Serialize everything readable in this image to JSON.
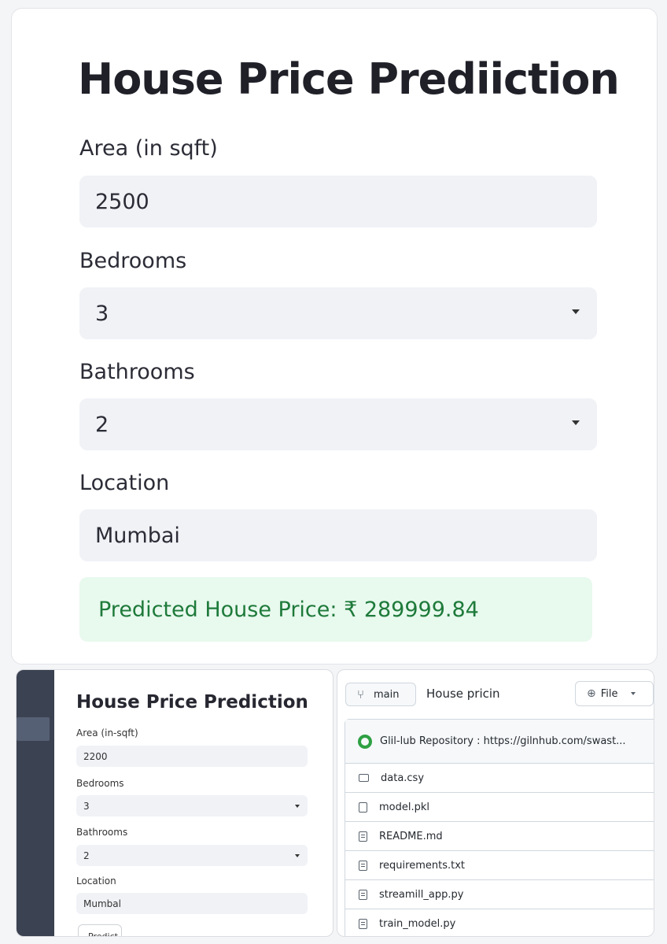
{
  "main_app": {
    "title": "House Price Prediiction",
    "fields": [
      {
        "label": "Area (in sqft)",
        "value": "2500",
        "type": "number"
      },
      {
        "label": "Bedrooms",
        "value": "3",
        "type": "select"
      },
      {
        "label": "Bathrooms",
        "value": "2",
        "type": "select"
      },
      {
        "label": "Location",
        "value": "Mumbai",
        "type": "text"
      }
    ],
    "result": "Predicted House Price: ₹ 289999.84"
  },
  "preview_app": {
    "title": "House Price Prediction",
    "fields": [
      {
        "label": "Area (in-sqft)",
        "value": "2200",
        "type": "number"
      },
      {
        "label": "Bedrooms",
        "value": "3",
        "type": "select"
      },
      {
        "label": "Bathrooms",
        "value": "2",
        "type": "select"
      },
      {
        "label": "Location",
        "value": "Mumbal",
        "type": "text"
      }
    ],
    "button": "Predict"
  },
  "repo": {
    "branch": "main",
    "name": "House pricin",
    "file_button": "File",
    "header": "Glil-lub Repository : https://gilnhub.com/swast...",
    "files": [
      {
        "name": "data.csy",
        "icon": "folder-icon"
      },
      {
        "name": "model.pkl",
        "icon": "file-icon"
      },
      {
        "name": "README.md",
        "icon": "doc-icon"
      },
      {
        "name": "requirements.txt",
        "icon": "doc-icon"
      },
      {
        "name": "streamill_app.py",
        "icon": "doc-icon"
      },
      {
        "name": "train_model.py",
        "icon": "doc-icon"
      }
    ]
  },
  "colors": {
    "success_bg": "#e8f9ee",
    "success_text": "#1e7a3a",
    "input_bg": "#f0f2f6",
    "sidebar": "#3b4251"
  }
}
